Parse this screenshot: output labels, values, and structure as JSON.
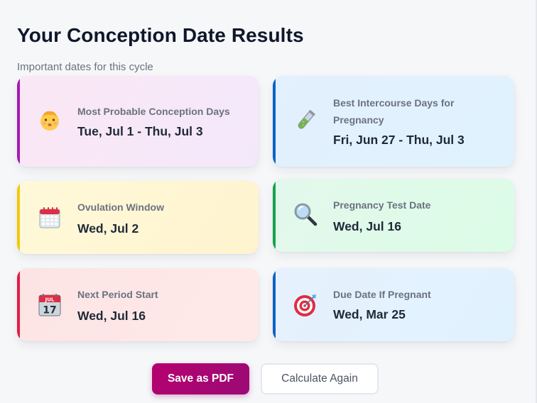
{
  "header": {
    "title": "Your Conception Date Results",
    "subtitle": "Important dates for this cycle"
  },
  "cards": [
    {
      "icon": "baby-face-icon",
      "label": "Most Probable Conception Days",
      "value": "Tue, Jul 1 - Thu, Jul 3",
      "accent_color": "#a21caf"
    },
    {
      "icon": "test-tube-icon",
      "label": "Best Intercourse Days for Pregnancy",
      "value": "Fri, Jun 27 - Thu, Jul 3",
      "accent_color": "#0b63c5"
    },
    {
      "icon": "calendar-icon",
      "label": "Ovulation Window",
      "value": "Wed, Jul 2",
      "accent_color": "#f2c90c"
    },
    {
      "icon": "magnifying-glass-icon",
      "label": "Pregnancy Test Date",
      "value": "Wed, Jul 16",
      "accent_color": "#16a34a"
    },
    {
      "icon": "calendar-date-icon",
      "icon_text": "JUL",
      "icon_day": "17",
      "label": "Next Period Start",
      "value": "Wed, Jul 16",
      "accent_color": "#e11d48"
    },
    {
      "icon": "target-icon",
      "label": "Due Date If Pregnant",
      "value": "Wed, Mar 25",
      "accent_color": "#0b63c5"
    }
  ],
  "actions": {
    "save_pdf_label": "Save as PDF",
    "calculate_again_label": "Calculate Again",
    "primary_color": "#b5006e"
  }
}
